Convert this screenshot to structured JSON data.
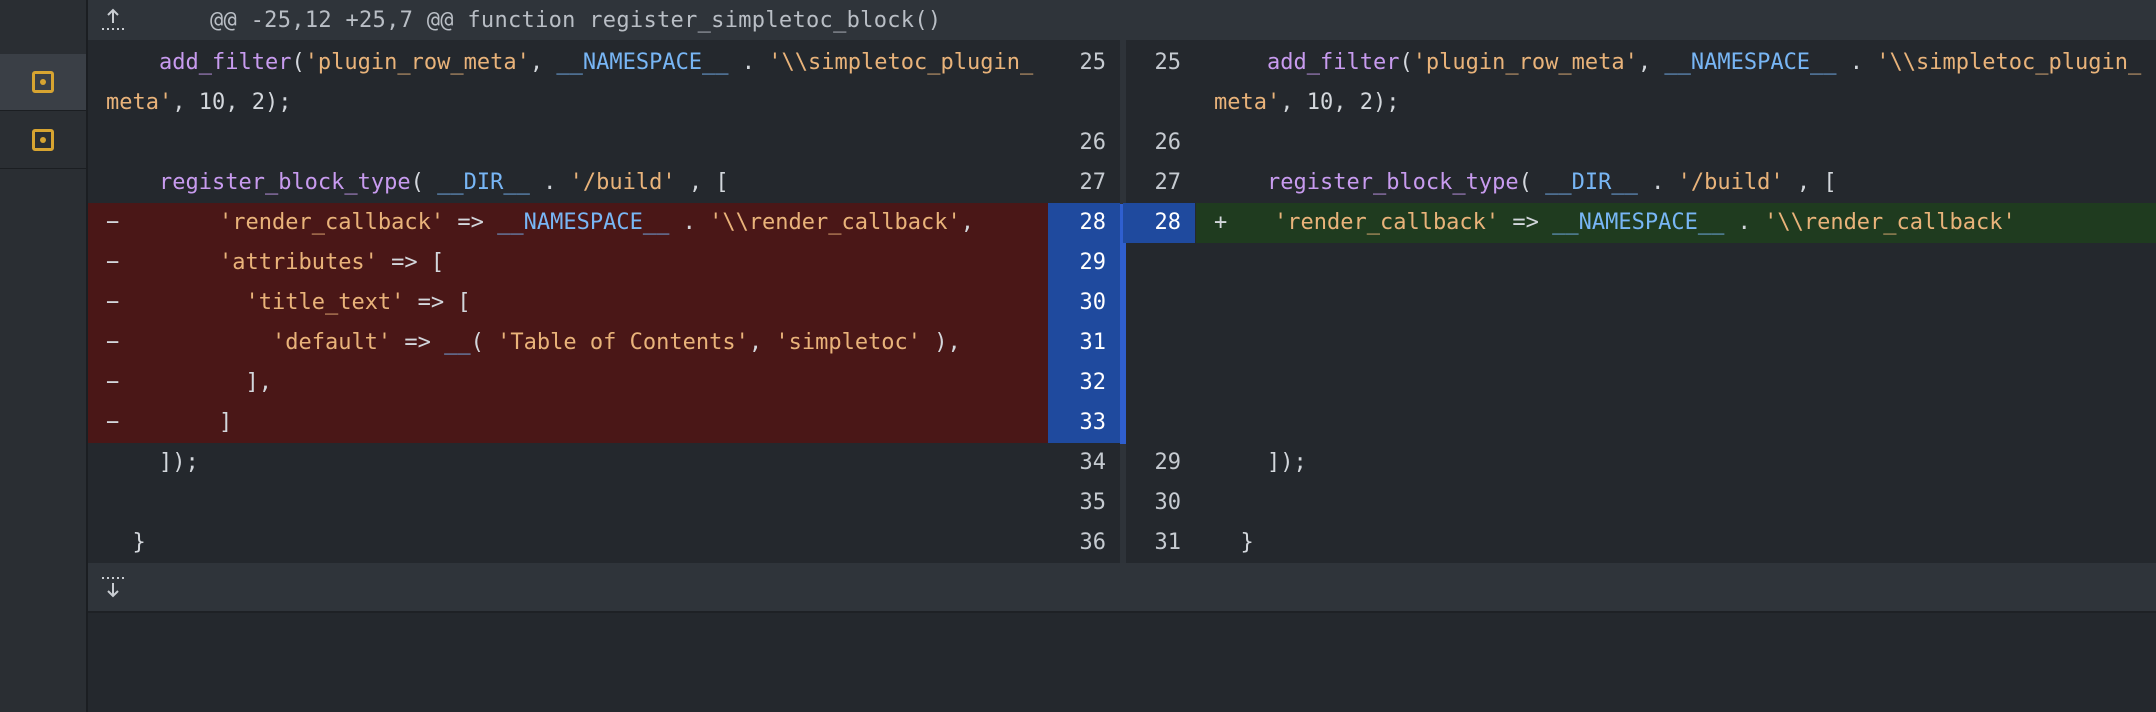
{
  "hunk": {
    "header": "@@ -25,12 +25,7 @@ function register_simpletoc_block()"
  },
  "left_lines": [
    {
      "num": "25",
      "parts": [
        [
          "fn",
          "add_filter"
        ],
        [
          "txt",
          "("
        ],
        [
          "str",
          "'plugin_row_meta'"
        ],
        [
          "txt",
          ", "
        ],
        [
          "const",
          "__NAMESPACE__"
        ],
        [
          "txt",
          " . "
        ],
        [
          "str",
          "'\\\\simpletoc_plugin_"
        ]
      ],
      "cont": [
        [
          "str",
          "meta'"
        ],
        [
          "txt",
          ", 10, 2);"
        ]
      ]
    },
    {
      "num": "26",
      "parts": []
    },
    {
      "num": "27",
      "parts": [
        [
          "fn",
          "register_block_type"
        ],
        [
          "txt",
          "( "
        ],
        [
          "const",
          "__DIR__"
        ],
        [
          "txt",
          " . "
        ],
        [
          "str",
          "'/build'"
        ],
        [
          "txt",
          " , ["
        ]
      ]
    },
    {
      "num": "28",
      "del": true,
      "parts": [
        [
          "str",
          "'render_callback'"
        ],
        [
          "txt",
          " => "
        ],
        [
          "const",
          "__NAMESPACE__"
        ],
        [
          "txt",
          " . "
        ],
        [
          "str",
          "'\\\\render_callback'"
        ],
        [
          "txt",
          ","
        ]
      ]
    },
    {
      "num": "29",
      "del": true,
      "parts": [
        [
          "str",
          "'attributes'"
        ],
        [
          "txt",
          " => ["
        ]
      ]
    },
    {
      "num": "30",
      "del": true,
      "parts": [
        [
          "str",
          "'title_text'"
        ],
        [
          "txt",
          " => ["
        ]
      ]
    },
    {
      "num": "31",
      "del": true,
      "parts": [
        [
          "str",
          "'default'"
        ],
        [
          "txt",
          " => "
        ],
        [
          "const",
          "__"
        ],
        [
          "txt",
          "( "
        ],
        [
          "str",
          "'Table of Contents'"
        ],
        [
          "txt",
          ", "
        ],
        [
          "str",
          "'simpletoc'"
        ],
        [
          "txt",
          " ),"
        ]
      ]
    },
    {
      "num": "32",
      "del": true,
      "parts": [
        [
          "txt",
          "],"
        ]
      ]
    },
    {
      "num": "33",
      "del": true,
      "parts": [
        [
          "txt",
          "]"
        ]
      ]
    },
    {
      "num": "34",
      "parts": [
        [
          "txt",
          "]);"
        ]
      ]
    },
    {
      "num": "35",
      "parts": []
    },
    {
      "num": "36",
      "parts": [
        [
          "txt",
          "}"
        ]
      ]
    }
  ],
  "right_lines": [
    {
      "num": "25",
      "parts": [
        [
          "fn",
          "add_filter"
        ],
        [
          "txt",
          "("
        ],
        [
          "str",
          "'plugin_row_meta'"
        ],
        [
          "txt",
          ", "
        ],
        [
          "const",
          "__NAMESPACE__"
        ],
        [
          "txt",
          " . "
        ],
        [
          "str",
          "'\\\\simpletoc_plugin_"
        ]
      ],
      "cont": [
        [
          "str",
          "meta'"
        ],
        [
          "txt",
          ", 10, 2);"
        ]
      ]
    },
    {
      "num": "26",
      "parts": []
    },
    {
      "num": "27",
      "parts": [
        [
          "fn",
          "register_block_type"
        ],
        [
          "txt",
          "( "
        ],
        [
          "const",
          "__DIR__"
        ],
        [
          "txt",
          " . "
        ],
        [
          "str",
          "'/build'"
        ],
        [
          "txt",
          " , ["
        ]
      ]
    },
    {
      "num": "28",
      "add": true,
      "parts": [
        [
          "str",
          "'render_callback'"
        ],
        [
          "txt",
          " => "
        ],
        [
          "const",
          "__NAMESPACE__"
        ],
        [
          "txt",
          " . "
        ],
        [
          "str",
          "'\\\\render_callback'"
        ]
      ]
    },
    {
      "num": "",
      "parts": []
    },
    {
      "num": "",
      "parts": []
    },
    {
      "num": "",
      "parts": []
    },
    {
      "num": "",
      "parts": []
    },
    {
      "num": "",
      "parts": []
    },
    {
      "num": "29",
      "parts": [
        [
          "txt",
          "]);"
        ]
      ]
    },
    {
      "num": "30",
      "parts": []
    },
    {
      "num": "31",
      "parts": [
        [
          "txt",
          "}"
        ]
      ]
    }
  ],
  "markers": {
    "del": "−",
    "add": "+"
  },
  "colors": {
    "deleted_bg": "#4a1717",
    "added_bg": "#1f3b1f",
    "line_highlight": "#1f4a9e",
    "file_icon": "#d7a431"
  },
  "icons": {
    "expand_up": "expand-up-icon",
    "expand_down": "expand-down-icon",
    "file": "file-icon"
  }
}
